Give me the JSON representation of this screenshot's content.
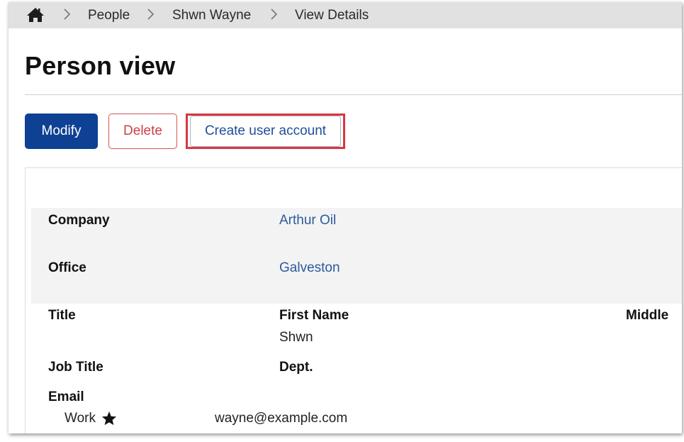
{
  "breadcrumb": {
    "items": [
      "People",
      "Shwn Wayne",
      "View Details"
    ]
  },
  "page": {
    "title": "Person view"
  },
  "actions": {
    "modify_label": "Modify",
    "delete_label": "Delete",
    "create_account_label": "Create user account"
  },
  "details": {
    "company_label": "Company",
    "company_value": "Arthur Oil",
    "office_label": "Office",
    "office_value": "Galveston",
    "title_label": "Title",
    "first_name_label": "First Name",
    "first_name_value": "Shwn",
    "middle_label": "Middle",
    "job_title_label": "Job Title",
    "dept_label": "Dept.",
    "email_label": "Email",
    "email_type": "Work",
    "email_value": "wayne@example.com"
  },
  "colors": {
    "primary": "#0e4194",
    "danger": "#cc3f47",
    "link": "#2c5a9c",
    "highlight": "#d9363e",
    "breadcrumb_bg": "#e1e1e1"
  },
  "icons": {
    "home": "home-icon",
    "separator": "chevron-right-icon",
    "primary_email": "star-icon"
  }
}
